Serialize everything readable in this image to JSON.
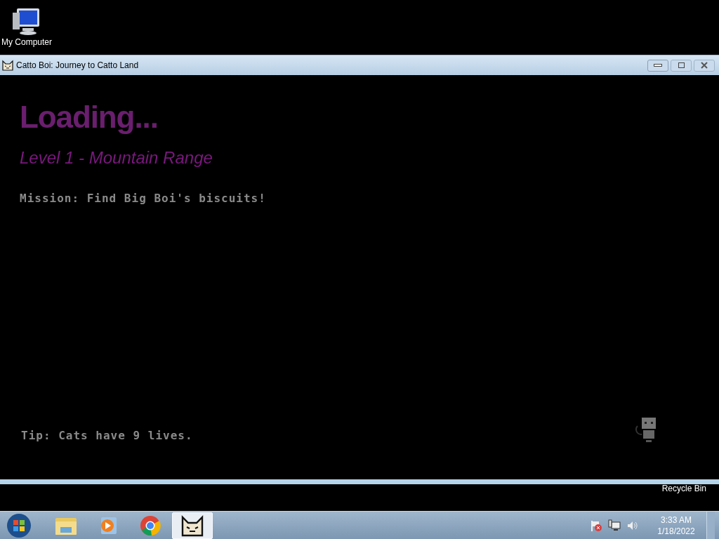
{
  "desktop_icons": [
    {
      "label": "My Computer"
    }
  ],
  "window": {
    "title": "Catto Boi: Journey to Catto Land"
  },
  "game": {
    "heading": "Loading...",
    "level": "Level 1 - Mountain Range",
    "mission": "Mission: Find Big Boi's biscuits!",
    "tip": "Tip: Cats have 9 lives."
  },
  "hidden_desktop_icon": {
    "label": "Recycle Bin"
  },
  "taskbar": {
    "apps": [
      {
        "kind": "explorer",
        "selected": false
      },
      {
        "kind": "media",
        "selected": false
      },
      {
        "kind": "chrome",
        "selected": false
      },
      {
        "kind": "catto",
        "selected": true
      }
    ],
    "time": "3:33 AM",
    "date": "1/18/2022"
  }
}
